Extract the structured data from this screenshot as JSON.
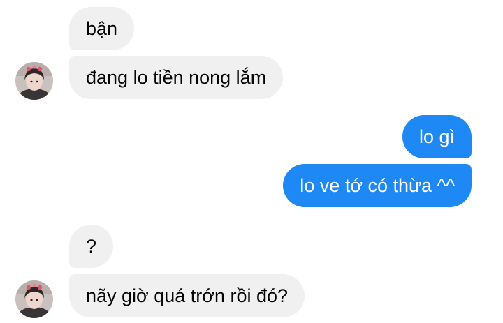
{
  "conversation": {
    "messages": [
      {
        "sender": "them",
        "text": "bận"
      },
      {
        "sender": "them",
        "text": "đang lo tiền nong lắm"
      },
      {
        "sender": "me",
        "text": "lo gì"
      },
      {
        "sender": "me",
        "text": "lo ve tớ có thừa ^^"
      },
      {
        "sender": "them",
        "text": "?"
      },
      {
        "sender": "them",
        "text": "nãy giờ quá trớn rồi đó?"
      }
    ]
  },
  "colors": {
    "incoming_bubble": "#f0f0f0",
    "outgoing_bubble": "#1e88f5",
    "incoming_text": "#050505",
    "outgoing_text": "#ffffff"
  },
  "icons": {
    "avatar": "contact-avatar-photo"
  }
}
